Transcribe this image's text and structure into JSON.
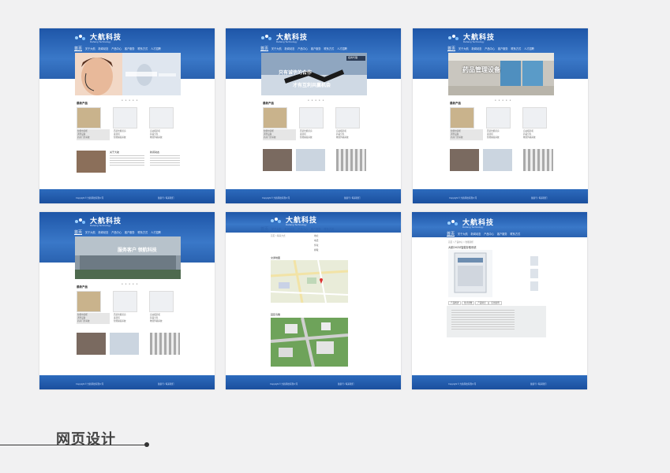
{
  "caption": "网页设计",
  "logo": {
    "name": "大航科技",
    "sub": "Dahang Technology"
  },
  "nav": {
    "items": [
      "首页",
      "关于大航",
      "新闻动态",
      "产品中心",
      "客户服务",
      "联系方式",
      "人才招聘"
    ]
  },
  "banners": {
    "card2_line1": "只有诚信的合作",
    "card2_line2": "才有互利共赢机会",
    "card2_badge": "招商代理",
    "card3_title": "药品管理设备",
    "card4_title": "服务客户 领航科技"
  },
  "home": {
    "products_title": "最新产品",
    "col1": [
      "智能中药柜",
      "调剂设备",
      "药房门诊系统"
    ],
    "col2": [
      "西药智能药房",
      "发药机",
      "智能输液系统"
    ],
    "col3": [
      "自动摆药机",
      "药品分包",
      "物流传输系统"
    ],
    "intro_title": "关于大航",
    "news_title": "新闻动态"
  },
  "card5": {
    "breadcrumb": "首页 > 联系方式",
    "map_title": "交通地图",
    "aerial_title": "园区鸟瞰",
    "contact_items": [
      "地址：",
      "电话：",
      "传真：",
      "邮箱："
    ]
  },
  "card6": {
    "breadcrumb": "首页 > 产品中心 > 智能药柜",
    "product_title": "大航DH202智能存取系统",
    "tabs": [
      "产品概述",
      "技术参数",
      "产品特点",
      "应用案例"
    ]
  },
  "footer": {
    "left": "Copyright © 大航科技有限公司",
    "right": "备案号 / 联系我们"
  },
  "colors": {
    "header": "#2a62b0",
    "footer": "#1b4f9e",
    "bg": "#f1f1f2"
  }
}
